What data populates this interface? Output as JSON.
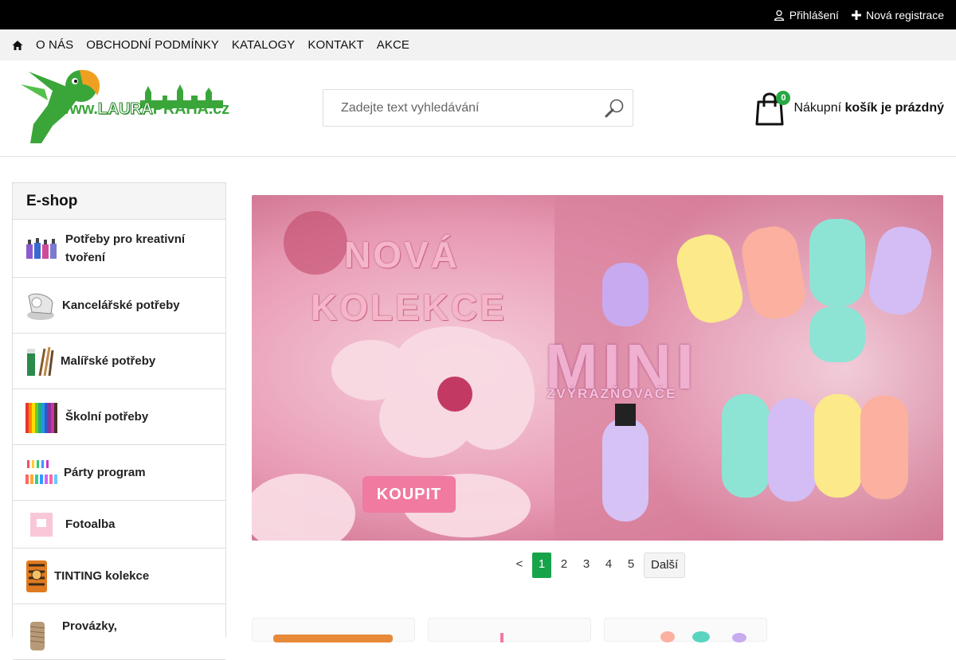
{
  "topbar": {
    "login_label": "Přihlášení",
    "register_label": "Nová registrace"
  },
  "nav": {
    "items": [
      "O NÁS",
      "OBCHODNÍ PODMÍNKY",
      "KATALOGY",
      "KONTAKT",
      "AKCE"
    ]
  },
  "logo": {
    "www": "www.",
    "laura": "LAURA",
    "praha": "PRAHA.cz"
  },
  "search": {
    "placeholder": "Zadejte text vyhledávání"
  },
  "cart": {
    "count": "0",
    "label_prefix": "Nákupní",
    "label_bold": "košík je prázdný"
  },
  "sidebar": {
    "title": "E-shop",
    "categories": [
      {
        "label": "Potřeby pro kreativní tvoření"
      },
      {
        "label": "Kancelářské potřeby"
      },
      {
        "label": "Malířské potřeby"
      },
      {
        "label": "Školní potřeby"
      },
      {
        "label": "Párty program"
      },
      {
        "label": "Fotoalba"
      },
      {
        "label": "TINTING kolekce"
      },
      {
        "label": "Provázky,"
      }
    ]
  },
  "banner": {
    "line1": "NOVÁ",
    "line2": "KOLEKCE",
    "line3": "MINI",
    "line4": "ZVÝRAZŇOVAČE",
    "button": "KOUPIT"
  },
  "pager": {
    "prev": "<",
    "pages": [
      "1",
      "2",
      "3",
      "4",
      "5"
    ],
    "active": "1",
    "next": "Další"
  },
  "colors": {
    "accent": "#17a34a",
    "topbar": "#000000",
    "nav_bg": "#f2f2f2"
  }
}
